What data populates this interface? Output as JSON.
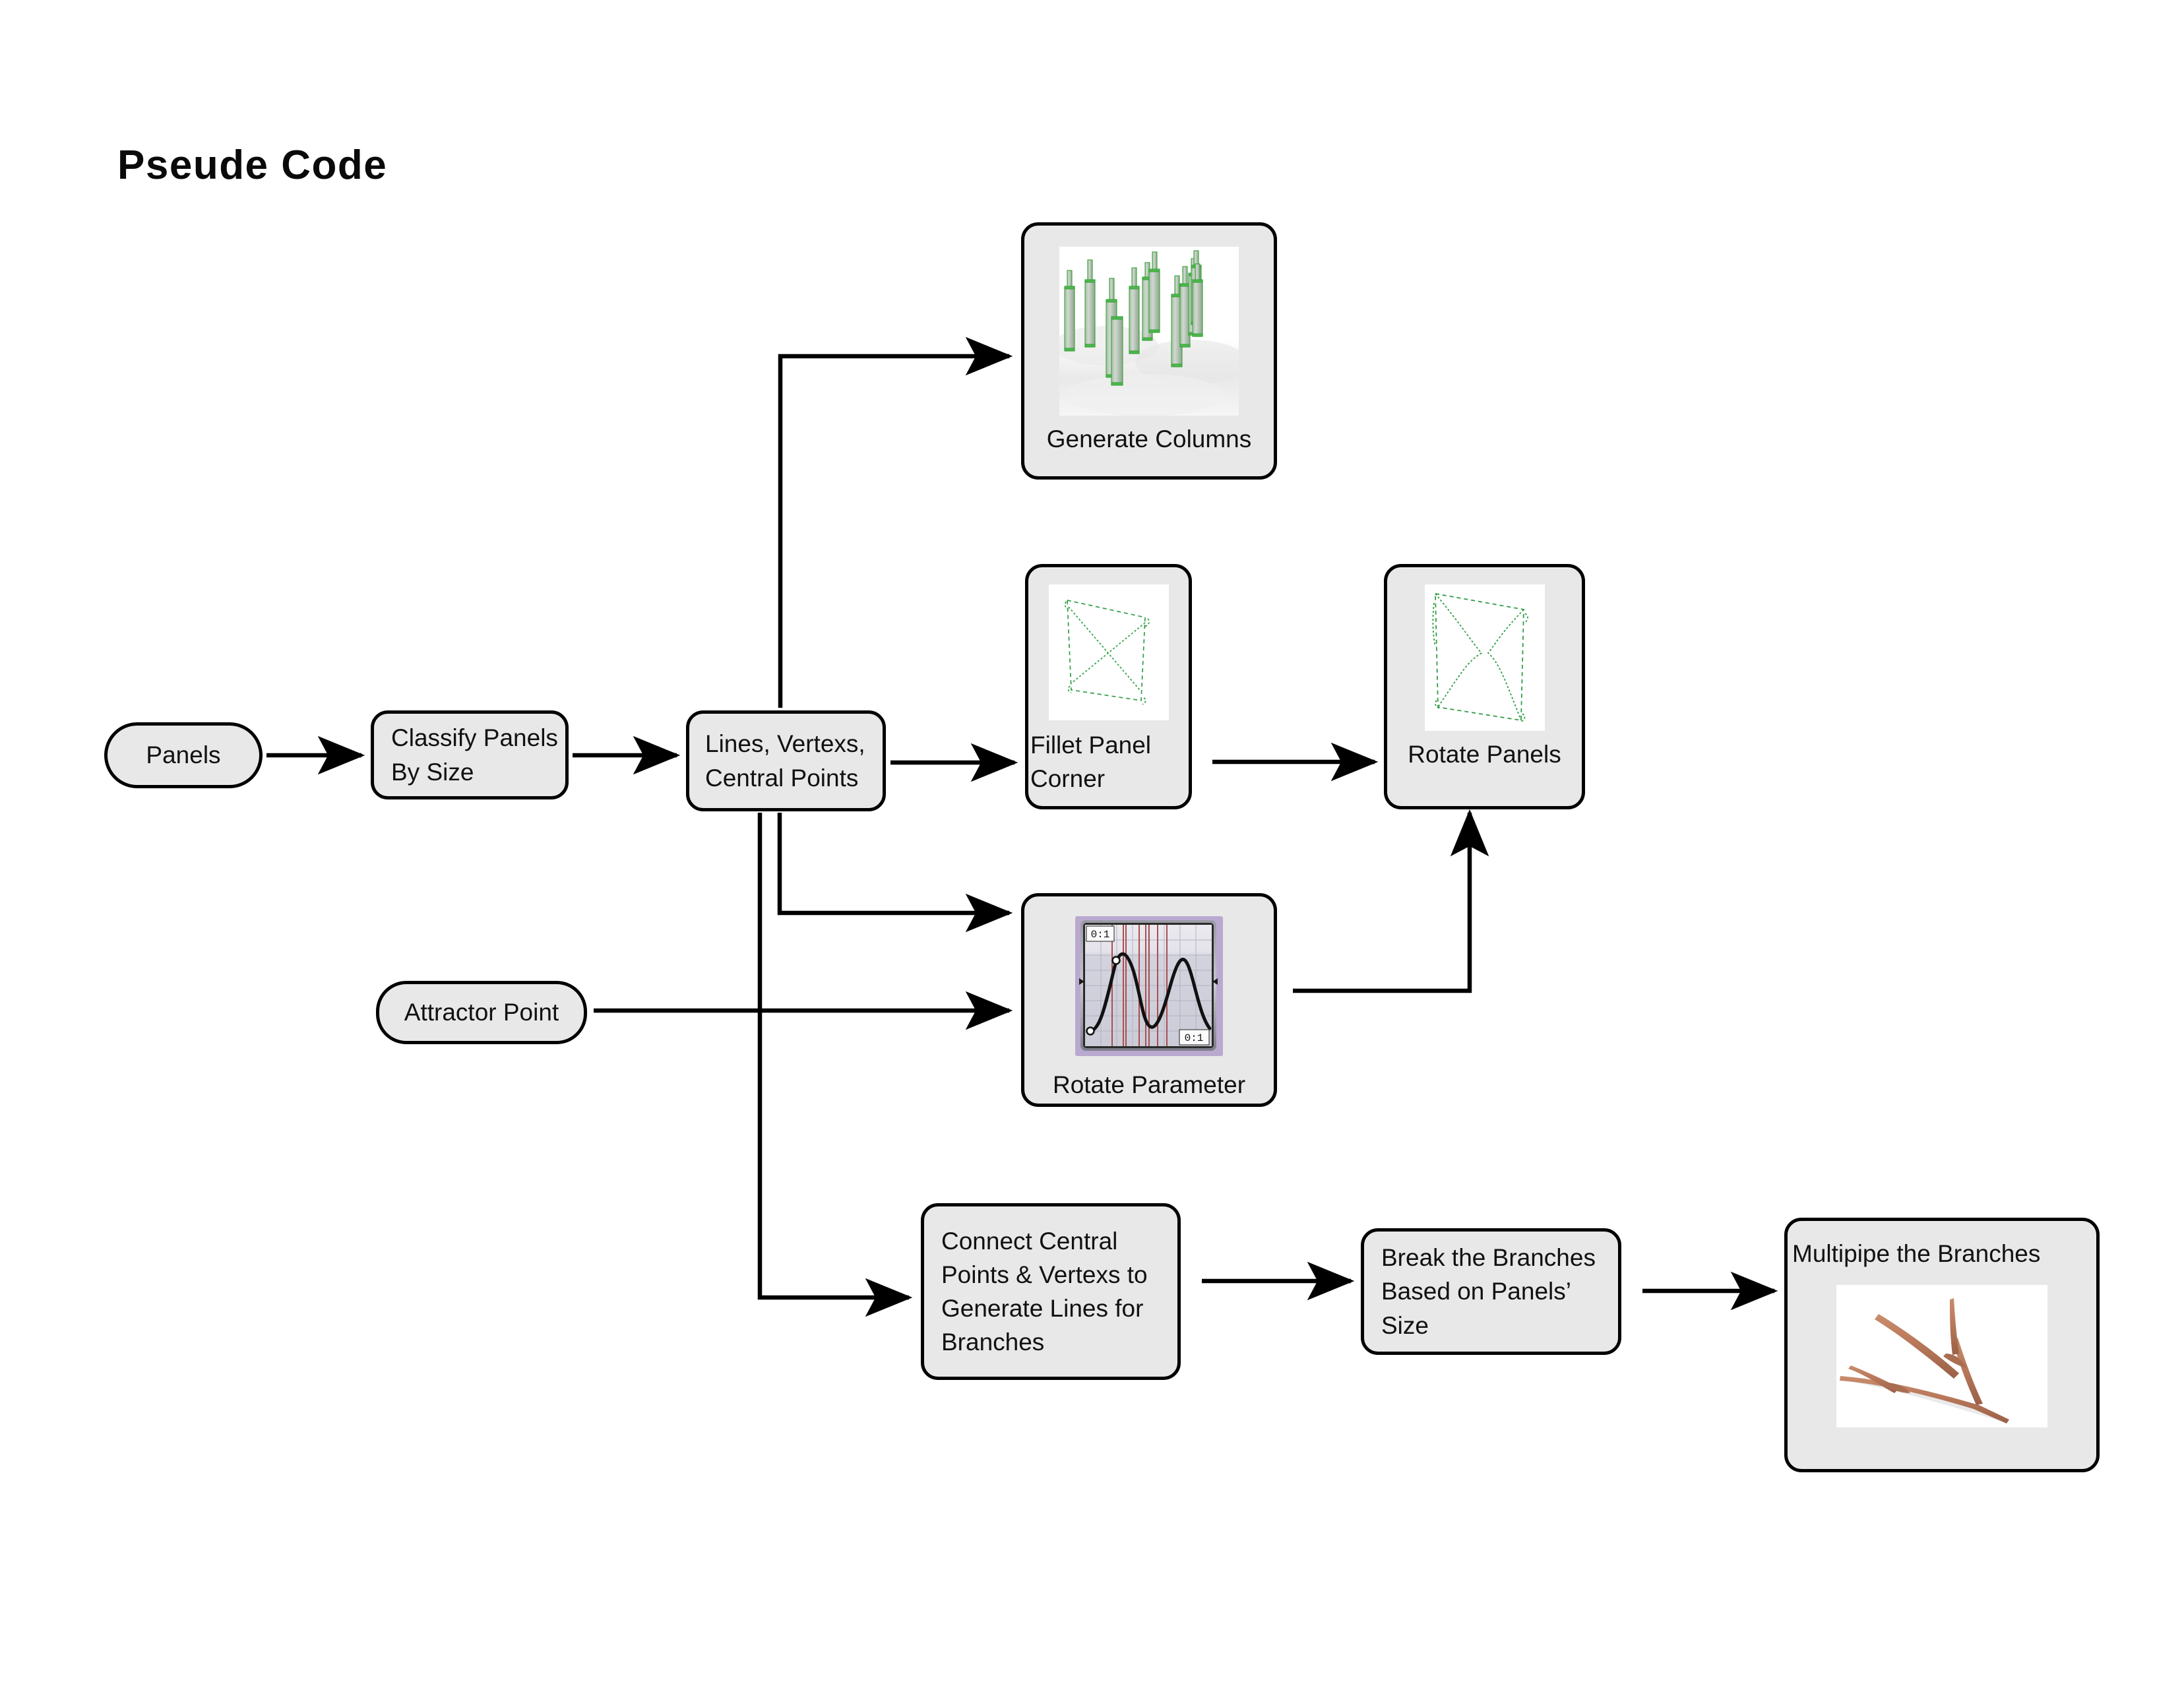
{
  "page": {
    "title": "Pseude Code",
    "background_color": "#ffffff",
    "node_fill": "#e8e8e8",
    "node_stroke": "#000000",
    "connector_color": "#000000"
  },
  "nodes": [
    {
      "id": "panels",
      "label": "Panels"
    },
    {
      "id": "classify",
      "label": "Classify Panels\nBy Size"
    },
    {
      "id": "lines",
      "label": "Lines, Vertexs,\nCentral Points"
    },
    {
      "id": "attractor",
      "label": "Attractor Point"
    },
    {
      "id": "columns",
      "label": "Generate Columns"
    },
    {
      "id": "fillet",
      "label": "Fillet Panel\nCorner"
    },
    {
      "id": "rotate_panels",
      "label": "Rotate Panels"
    },
    {
      "id": "rotate_param",
      "label": "Rotate Parameter"
    },
    {
      "id": "connect",
      "label": "Connect Central\nPoints & Vertexs to\nGenerate Lines for\nBranches"
    },
    {
      "id": "break",
      "label": "Break the Branches\nBased on Panels’\nSize"
    },
    {
      "id": "multipipe",
      "label": "Multipipe the Branches"
    }
  ],
  "thumbnails": {
    "columns": {
      "name": "generate-columns-render",
      "description": "3D render of slender vertical columns of varying heights on a white ground plane",
      "column_color": "#96b096",
      "edge_color": "#3aa33a",
      "ground_color": "#f2f2f2"
    },
    "fillet": {
      "name": "fillet-panel-corner-render",
      "description": "Green dashed quadrilateral panel outline with crossing diagonals",
      "line_color": "#2f9e44"
    },
    "rotate_panels": {
      "name": "rotate-panels-render",
      "description": "Green dotted four-point star/X panel outline rotated",
      "line_color": "#2f9e44"
    },
    "rotate_param": {
      "name": "graph-mapper-component",
      "description": "Grasshopper graph mapper with a sine curve, red sample lines and 0:1 domain labels",
      "top_left_label": "0:1",
      "bottom_right_label": "0:1",
      "curve_color": "#111111",
      "sample_line_color": "#a85050",
      "frame_color": "#b9a9cf",
      "grid_color": "#b8b8c8",
      "plot_bg": "#d2d2dc"
    },
    "multipipe": {
      "name": "multipipe-branches-render",
      "description": "Tan/brown multipipe branching mesh of tree-like branches",
      "branch_color": "#b9785a",
      "branch_shadow": "#8d5840"
    }
  },
  "connections": [
    {
      "from": "panels",
      "to": "classify",
      "style": "straight-arrow"
    },
    {
      "from": "classify",
      "to": "lines",
      "style": "straight-arrow"
    },
    {
      "from": "lines",
      "to": "columns",
      "style": "elbow-up-right-arrow"
    },
    {
      "from": "lines",
      "to": "fillet",
      "style": "straight-arrow"
    },
    {
      "from": "lines",
      "to": "rotate_param",
      "style": "elbow-down-right-arrow"
    },
    {
      "from": "lines",
      "to": "connect",
      "style": "elbow-down-right-arrow"
    },
    {
      "from": "attractor",
      "to": "rotate_param",
      "style": "straight-arrow"
    },
    {
      "from": "fillet",
      "to": "rotate_panels",
      "style": "straight-arrow"
    },
    {
      "from": "rotate_param",
      "to": "rotate_panels",
      "style": "elbow-right-up-arrow"
    },
    {
      "from": "connect",
      "to": "break",
      "style": "straight-arrow"
    },
    {
      "from": "break",
      "to": "multipipe",
      "style": "straight-arrow"
    }
  ]
}
